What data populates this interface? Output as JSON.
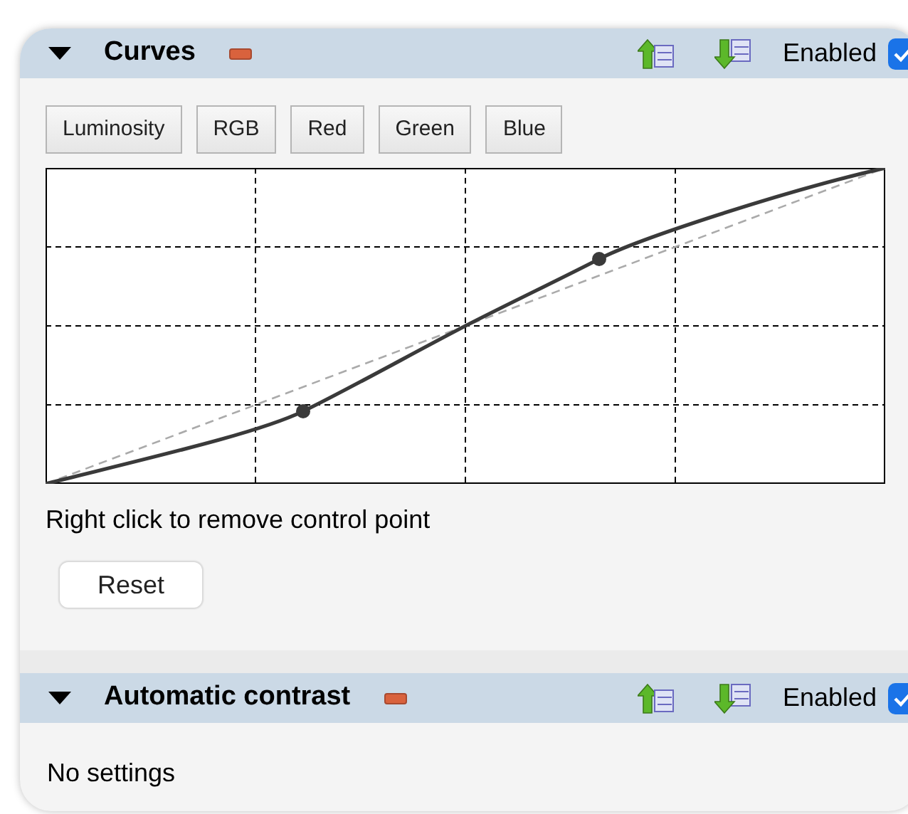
{
  "sections": [
    {
      "kind": "curves",
      "title": "Curves",
      "expanded": true,
      "enabled": true,
      "enabled_label": "Enabled",
      "channels": [
        "Luminosity",
        "RGB",
        "Red",
        "Green",
        "Blue"
      ],
      "hint": "Right click to remove control point",
      "reset_label": "Reset"
    },
    {
      "kind": "message",
      "title": "Automatic contrast",
      "expanded": true,
      "enabled": true,
      "enabled_label": "Enabled",
      "message": "No settings"
    }
  ]
}
